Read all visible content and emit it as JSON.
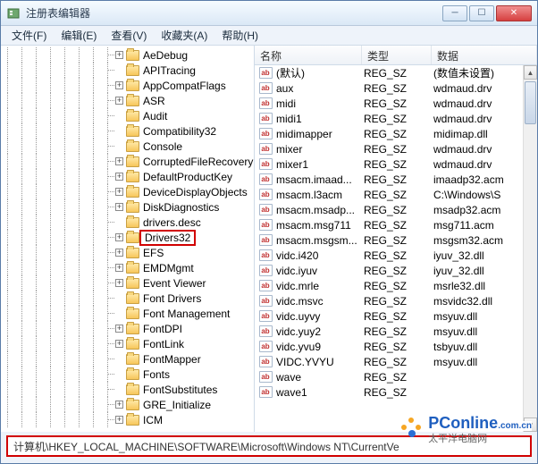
{
  "window": {
    "title": "注册表编辑器"
  },
  "menu": {
    "file": "文件(F)",
    "edit": "编辑(E)",
    "view": "查看(V)",
    "favorites": "收藏夹(A)",
    "help": "帮助(H)"
  },
  "tree": {
    "items": [
      {
        "label": "AeDebug",
        "exp": "+"
      },
      {
        "label": "APITracing",
        "exp": ""
      },
      {
        "label": "AppCompatFlags",
        "exp": "+"
      },
      {
        "label": "ASR",
        "exp": "+"
      },
      {
        "label": "Audit",
        "exp": ""
      },
      {
        "label": "Compatibility32",
        "exp": ""
      },
      {
        "label": "Console",
        "exp": ""
      },
      {
        "label": "CorruptedFileRecovery",
        "exp": "+"
      },
      {
        "label": "DefaultProductKey",
        "exp": "+"
      },
      {
        "label": "DeviceDisplayObjects",
        "exp": "+"
      },
      {
        "label": "DiskDiagnostics",
        "exp": "+"
      },
      {
        "label": "drivers.desc",
        "exp": ""
      },
      {
        "label": "Drivers32",
        "exp": "+",
        "hl": true
      },
      {
        "label": "EFS",
        "exp": "+"
      },
      {
        "label": "EMDMgmt",
        "exp": "+"
      },
      {
        "label": "Event Viewer",
        "exp": "+"
      },
      {
        "label": "Font Drivers",
        "exp": ""
      },
      {
        "label": "Font Management",
        "exp": ""
      },
      {
        "label": "FontDPI",
        "exp": "+"
      },
      {
        "label": "FontLink",
        "exp": "+"
      },
      {
        "label": "FontMapper",
        "exp": ""
      },
      {
        "label": "Fonts",
        "exp": ""
      },
      {
        "label": "FontSubstitutes",
        "exp": ""
      },
      {
        "label": "GRE_Initialize",
        "exp": "+"
      },
      {
        "label": "ICM",
        "exp": "+"
      }
    ]
  },
  "list": {
    "header": {
      "name": "名称",
      "type": "类型",
      "data": "数据"
    },
    "rows": [
      {
        "name": "(默认)",
        "type": "REG_SZ",
        "data": "(数值未设置)"
      },
      {
        "name": "aux",
        "type": "REG_SZ",
        "data": "wdmaud.drv"
      },
      {
        "name": "midi",
        "type": "REG_SZ",
        "data": "wdmaud.drv"
      },
      {
        "name": "midi1",
        "type": "REG_SZ",
        "data": "wdmaud.drv"
      },
      {
        "name": "midimapper",
        "type": "REG_SZ",
        "data": "midimap.dll"
      },
      {
        "name": "mixer",
        "type": "REG_SZ",
        "data": "wdmaud.drv"
      },
      {
        "name": "mixer1",
        "type": "REG_SZ",
        "data": "wdmaud.drv"
      },
      {
        "name": "msacm.imaad...",
        "type": "REG_SZ",
        "data": "imaadp32.acm"
      },
      {
        "name": "msacm.l3acm",
        "type": "REG_SZ",
        "data": "C:\\Windows\\S"
      },
      {
        "name": "msacm.msadp...",
        "type": "REG_SZ",
        "data": "msadp32.acm"
      },
      {
        "name": "msacm.msg711",
        "type": "REG_SZ",
        "data": "msg711.acm"
      },
      {
        "name": "msacm.msgsm...",
        "type": "REG_SZ",
        "data": "msgsm32.acm"
      },
      {
        "name": "vidc.i420",
        "type": "REG_SZ",
        "data": "iyuv_32.dll"
      },
      {
        "name": "vidc.iyuv",
        "type": "REG_SZ",
        "data": "iyuv_32.dll"
      },
      {
        "name": "vidc.mrle",
        "type": "REG_SZ",
        "data": "msrle32.dll"
      },
      {
        "name": "vidc.msvc",
        "type": "REG_SZ",
        "data": "msvidc32.dll"
      },
      {
        "name": "vidc.uyvy",
        "type": "REG_SZ",
        "data": "msyuv.dll"
      },
      {
        "name": "vidc.yuy2",
        "type": "REG_SZ",
        "data": "msyuv.dll"
      },
      {
        "name": "vidc.yvu9",
        "type": "REG_SZ",
        "data": "tsbyuv.dll"
      },
      {
        "name": "VIDC.YVYU",
        "type": "REG_SZ",
        "data": "msyuv.dll"
      },
      {
        "name": "wave",
        "type": "REG_SZ",
        "data": ""
      },
      {
        "name": "wave1",
        "type": "REG_SZ",
        "data": ""
      }
    ]
  },
  "statusbar": {
    "path": "计算机\\HKEY_LOCAL_MACHINE\\SOFTWARE\\Microsoft\\Windows NT\\CurrentVe"
  },
  "watermark": {
    "brand": "PConline",
    "suffix": ".com.cn",
    "cn": "太平洋电脑网"
  }
}
